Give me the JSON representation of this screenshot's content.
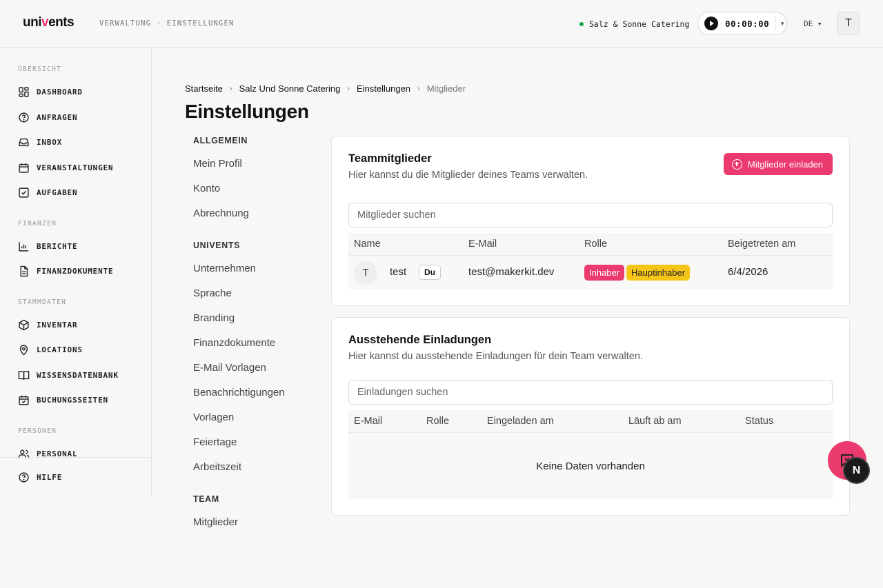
{
  "topbar": {
    "logo_prefix": "uni",
    "logo_accent": "v",
    "logo_suffix": "ents",
    "breadcrumb": "VERWALTUNG · EINSTELLUNGEN",
    "company": "Salz & Sonne Catering",
    "timer": "00:00:00",
    "language": "DE ▾",
    "avatar_initial": "T"
  },
  "sidebar": {
    "sections": [
      {
        "label": "ÜBERSICHT"
      },
      {
        "label": "FINANZEN"
      },
      {
        "label": "STAMMDATEN"
      },
      {
        "label": "PERSONEN"
      }
    ],
    "items": [
      {
        "label": "DASHBOARD",
        "icon": "dashboard-icon"
      },
      {
        "label": "ANFRAGEN",
        "icon": "help-circle-icon"
      },
      {
        "label": "INBOX",
        "icon": "inbox-icon"
      },
      {
        "label": "VERANSTALTUNGEN",
        "icon": "calendar-icon"
      },
      {
        "label": "AUFGABEN",
        "icon": "checkbox-icon"
      },
      {
        "label": "BERICHTE",
        "icon": "bar-chart-icon"
      },
      {
        "label": "FINANZDOKUMENTE",
        "icon": "document-icon"
      },
      {
        "label": "INVENTAR",
        "icon": "box-icon"
      },
      {
        "label": "LOCATIONS",
        "icon": "map-pin-icon"
      },
      {
        "label": "WISSENSDATENBANK",
        "icon": "book-icon"
      },
      {
        "label": "BUCHUNGSSEITEN",
        "icon": "calendar-check-icon"
      },
      {
        "label": "PERSONAL",
        "icon": "users-icon"
      }
    ],
    "help": {
      "label": "HILFE",
      "icon": "help-circle-icon"
    }
  },
  "breadcrumb": [
    "Startseite",
    "Salz Und Sonne Catering",
    "Einstellungen",
    "Mitglieder"
  ],
  "page_title": "Einstellungen",
  "settings_nav": {
    "general_heading": "ALLGEMEIN",
    "general": [
      "Mein Profil",
      "Konto",
      "Abrechnung"
    ],
    "univents_heading": "UNIVENTS",
    "univents": [
      "Unternehmen",
      "Sprache",
      "Branding",
      "Finanzdokumente",
      "E-Mail Vorlagen",
      "Benachrichtigungen",
      "Vorlagen",
      "Feiertage",
      "Arbeitszeit"
    ],
    "team_heading": "TEAM",
    "team": [
      "Mitglieder"
    ]
  },
  "members_card": {
    "title": "Teammitglieder",
    "description": "Hier kannst du die Mitglieder deines Teams verwalten.",
    "invite_button": "Mitglieder einladen",
    "search_placeholder": "Mitglieder suchen",
    "columns": [
      "Name",
      "E-Mail",
      "Rolle",
      "Beigetreten am"
    ],
    "rows": [
      {
        "initial": "T",
        "name": "test",
        "you_badge": "Du",
        "email": "test@makerkit.dev",
        "roles": [
          "Inhaber",
          "Hauptinhaber"
        ],
        "joined": "6/4/2026"
      }
    ]
  },
  "invites_card": {
    "title": "Ausstehende Einladungen",
    "description": "Hier kannst du ausstehende Einladungen für dein Team verwalten.",
    "search_placeholder": "Einladungen suchen",
    "columns": [
      "E-Mail",
      "Rolle",
      "Eingeladen am",
      "Läuft ab am",
      "Status"
    ],
    "empty_text": "Keine Daten vorhanden"
  },
  "floating": {
    "badge_letter": "N"
  },
  "colors": {
    "accent": "#ea3a6e",
    "owner_badge": "#ea3a6e",
    "main_owner_badge": "#f5c518",
    "status_dot": "#16a34a"
  }
}
